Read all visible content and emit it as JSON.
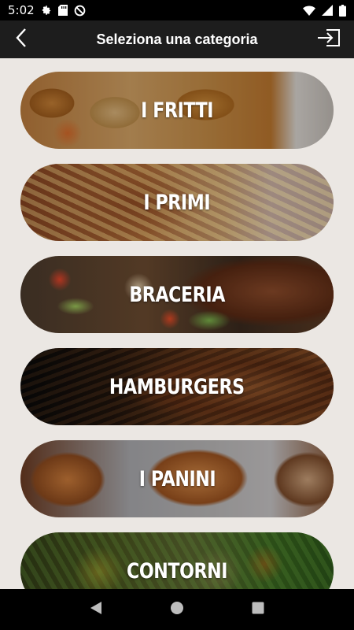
{
  "status_bar": {
    "time": "5:02",
    "left_icons": [
      "gear-icon",
      "sd-card-icon",
      "data-saver-icon"
    ],
    "right_icons": [
      "wifi-icon",
      "signal-icon",
      "battery-icon"
    ]
  },
  "app_bar": {
    "title": "Seleziona una categoria",
    "back_icon": "chevron-left-icon",
    "action_icon": "login-icon"
  },
  "categories": [
    {
      "label": "I FRITTI"
    },
    {
      "label": "I PRIMI"
    },
    {
      "label": "BRACERIA"
    },
    {
      "label": "HAMBURGERS"
    },
    {
      "label": "I PANINI"
    },
    {
      "label": "CONTORNI"
    }
  ],
  "nav_bar": {
    "buttons": [
      "back-triangle-icon",
      "home-circle-icon",
      "recents-square-icon"
    ]
  },
  "colors": {
    "background": "#ebe7e3",
    "app_bar": "#1d1d1d",
    "status_bar": "#000000"
  }
}
